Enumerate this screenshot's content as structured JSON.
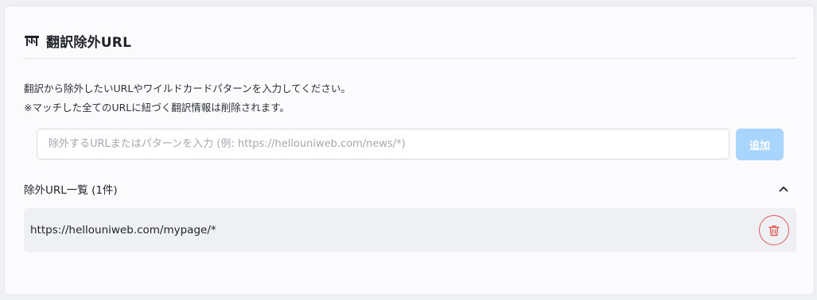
{
  "header": {
    "icon": "translate-off-icon",
    "title": "翻訳除外URL"
  },
  "description": {
    "line1": "翻訳から除外したいURLやワイルドカードパターンを入力してください。",
    "line2": "※マッチした全てのURLに紐づく翻訳情報は削除されます。"
  },
  "form": {
    "input_value": "",
    "input_placeholder": "除外するURLまたはパターンを入力 (例: https://hellouniweb.com/news/*)",
    "add_label": "追加"
  },
  "list": {
    "title": "除外URL一覧 (1件)",
    "toggle_icon": "chevron-up-icon",
    "items": [
      {
        "url": "https://hellouniweb.com/mypage/*",
        "delete_icon": "trash-icon"
      }
    ]
  },
  "colors": {
    "accent_disabled": "#a9d4fb",
    "danger": "#e05a5a",
    "row_bg": "#eff0f3"
  }
}
